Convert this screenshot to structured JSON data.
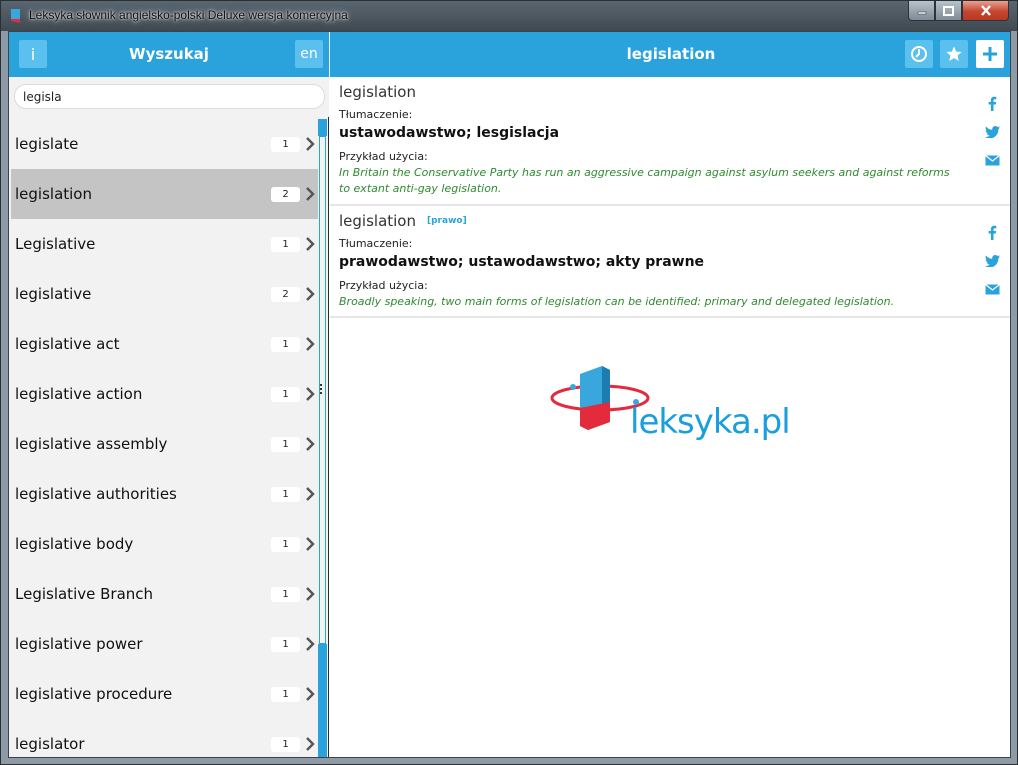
{
  "window": {
    "title": "Leksyka słownik angielsko-polski Deluxe wersja komercyjna"
  },
  "left_panel": {
    "info_label": "i",
    "title": "Wyszukaj",
    "lang_label": "en",
    "search_value": "legisla",
    "items": [
      {
        "word": "legislate",
        "count": "1",
        "selected": false
      },
      {
        "word": "legislation",
        "count": "2",
        "selected": true
      },
      {
        "word": "Legislative",
        "count": "1",
        "selected": false
      },
      {
        "word": "legislative",
        "count": "2",
        "selected": false
      },
      {
        "word": "legislative act",
        "count": "1",
        "selected": false
      },
      {
        "word": "legislative action",
        "count": "1",
        "selected": false
      },
      {
        "word": "legislative assembly",
        "count": "1",
        "selected": false
      },
      {
        "word": "legislative authorities",
        "count": "1",
        "selected": false
      },
      {
        "word": "legislative body",
        "count": "1",
        "selected": false
      },
      {
        "word": "Legislative Branch",
        "count": "1",
        "selected": false
      },
      {
        "word": "legislative power",
        "count": "1",
        "selected": false
      },
      {
        "word": "legislative procedure",
        "count": "1",
        "selected": false
      },
      {
        "word": "legislator",
        "count": "1",
        "selected": false
      }
    ]
  },
  "right_panel": {
    "title": "legislation",
    "entries": [
      {
        "headword": "legislation",
        "tag": "",
        "translation_label": "Tłumaczenie:",
        "translation": "ustawodawstwo; lesgislacja",
        "example_label": "Przykład użycia:",
        "example": "In Britain the Conservative Party has run an aggressive campaign against asylum seekers and against reforms to extant anti-gay legislation."
      },
      {
        "headword": "legislation",
        "tag": "[prawo]",
        "translation_label": "Tłumaczenie:",
        "translation": "prawodawstwo; ustawodawstwo; akty prawne",
        "example_label": "Przykład użycia:",
        "example": "Broadly speaking, two main forms of legislation can be identified: primary and delegated legislation."
      }
    ],
    "logo_text": "leksyka.pl"
  },
  "colors": {
    "accent": "#2aa3dc",
    "accent_light": "#5bc0ee",
    "selected_row": "#c4c4c4",
    "example_text": "#2f8a2f",
    "logo_red": "#e32b3b"
  }
}
